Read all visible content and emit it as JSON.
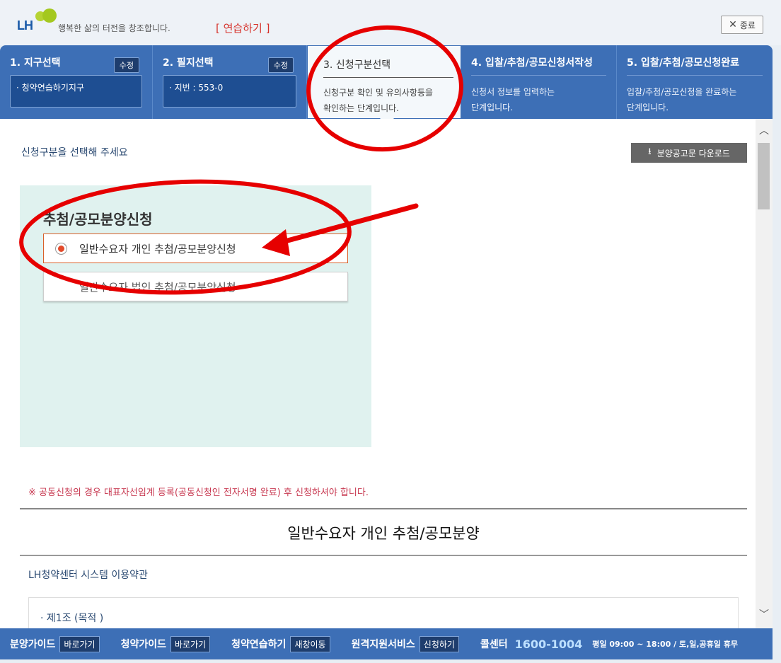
{
  "header": {
    "logo_text": "LH",
    "slogan": "행복한 삶의 터전을 창조합니다.",
    "practice_label": "[ 연습하기 ]",
    "close_label": "종료"
  },
  "steps": [
    {
      "title": "1. 지구선택",
      "edit_label": "수정",
      "value": "청약연습하기지구"
    },
    {
      "title": "2. 필지선택",
      "edit_label": "수정",
      "value": "지번 : 553-0"
    },
    {
      "title": "3. 신청구분선택",
      "desc_line1": "신청구분 확인 및 유의사항등을",
      "desc_line2": "확인하는 단계입니다."
    },
    {
      "title": "4. 입찰/추첨/공모신청서작성",
      "desc_line1": "신청서 정보를 입력하는",
      "desc_line2": "단계입니다."
    },
    {
      "title": "5. 입찰/추첨/공모신청완료",
      "desc_line1": "입찰/추첨/공모신청을 완료하는",
      "desc_line2": "단계입니다."
    }
  ],
  "main": {
    "prompt": "신청구분을 선택해 주세요",
    "download_label": "분양공고문 다운로드",
    "panel_title": "추첨/공모분양신청",
    "options": [
      {
        "label": "일반수요자 개인 추첨/공모분양신청",
        "selected": true
      },
      {
        "label": "일반수요자 법인 추첨/공모분양신청",
        "selected": false
      }
    ],
    "notice": "※ 공동신청의 경우 대표자선임계 등록(공동신청인 전자서명 완료) 후 신청하셔야 합니다.",
    "section_title": "일반수요자 개인 추첨/공모분양",
    "terms_title": "LH청약센터 시스템 이용약관",
    "terms_first_item": "제1조 (목적 )"
  },
  "footer": {
    "items": [
      {
        "label": "분양가이드",
        "button": "바로가기"
      },
      {
        "label": "청약가이드",
        "button": "바로가기"
      },
      {
        "label": "청약연습하기",
        "button": "새창이동"
      },
      {
        "label": "원격지원서비스",
        "button": "신청하기"
      }
    ],
    "call_label": "콜센터",
    "call_number": "1600-1004",
    "hours": "평일 09:00 ~ 18:00 / 토,일,공휴일 휴무"
  },
  "colors": {
    "step_bar": "#3d6fb6",
    "panel_bg": "#e0f2ef",
    "annotation_red": "#e60000",
    "notice": "#c83a52"
  }
}
